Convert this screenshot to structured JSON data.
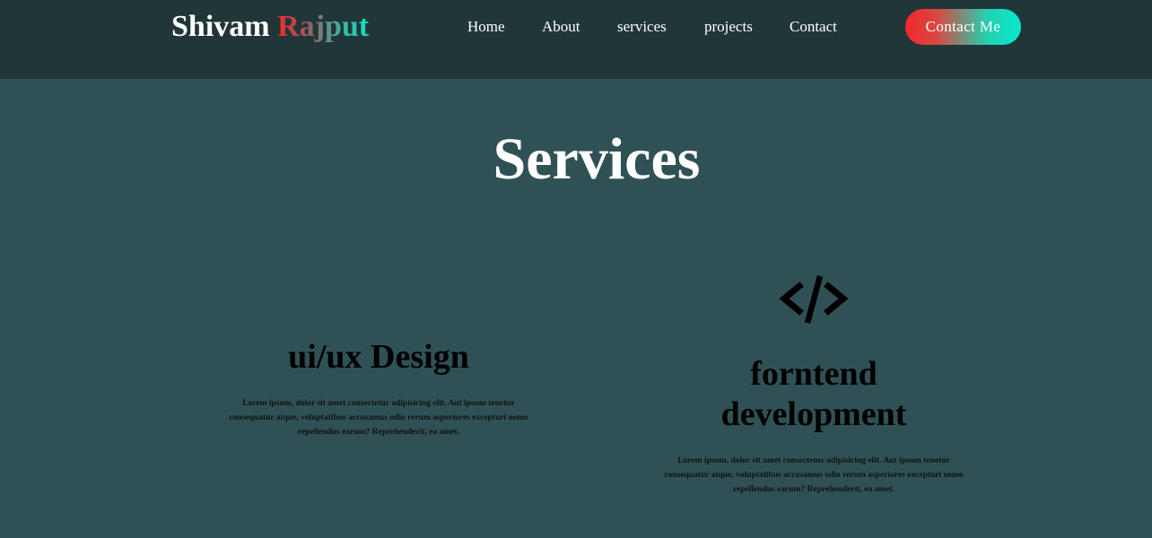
{
  "brand": {
    "first": "Shivam",
    "last": "Rajput"
  },
  "nav": {
    "items": [
      {
        "label": "Home"
      },
      {
        "label": "About"
      },
      {
        "label": "services"
      },
      {
        "label": "projects"
      },
      {
        "label": "Contact"
      }
    ],
    "cta_label": "Contact Me"
  },
  "services": {
    "title": "Services",
    "cards": [
      {
        "icon": "none",
        "title": "ui/ux Design",
        "description": "Lorem ipsum, dolor sit amet consectetur adipisicing elit. Aut ipsum tenetur consequatur atque, voluptatibus accusamus odio rerum asperiores excepturi nemo repellendus earum? Reprehenderit, ea amet."
      },
      {
        "icon": "code-icon",
        "title": "forntend development",
        "description": "Lorem ipsum, dolor sit amet consectetur adipisicing elit. Aut ipsum tenetur consequatur atque, voluptatibus accusamus odio rerum asperiores excepturi nemo repellendus earum? Reprehenderit, ea amet."
      }
    ]
  },
  "colors": {
    "header_bg": "#213639",
    "page_bg": "#2f5155",
    "gradient_start": "#f4272b",
    "gradient_end": "#06e8cf"
  }
}
